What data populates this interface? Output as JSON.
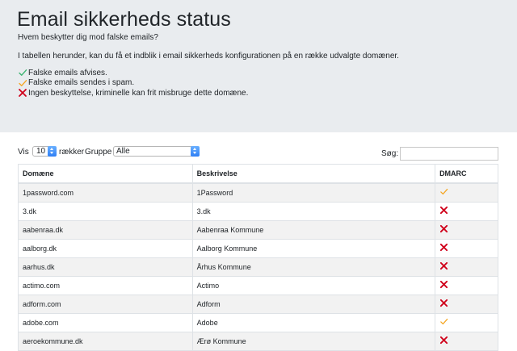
{
  "header": {
    "title": "Email sikkerheds status",
    "lead": "Hvem beskytter dig mod falske emails?",
    "description": "I tabellen herunder, kan du få et indblik i email sikkerheds konfigurationen på en række udvalgte domæner."
  },
  "legend": [
    {
      "icon": "check-green-icon",
      "color": "#3cb371",
      "text": "Falske emails afvises."
    },
    {
      "icon": "check-orange-icon",
      "color": "#f5a623",
      "text": "Falske emails sendes i spam."
    },
    {
      "icon": "cross-red-icon",
      "color": "#d0021b",
      "text": "Ingen beskyttelse, kriminelle kan frit misbruge dette domæne."
    }
  ],
  "controls": {
    "show_label": "Vis",
    "length_value": "10",
    "rows_label": "rækker",
    "group_label": "Gruppe",
    "group_value": "Alle",
    "search_label": "Søg:",
    "search_value": ""
  },
  "table": {
    "columns": [
      "Domæne",
      "Beskrivelse",
      "DMARC"
    ],
    "rows": [
      {
        "domain": "1password.com",
        "description": "1Password",
        "dmarc": "spam"
      },
      {
        "domain": "3.dk",
        "description": "3.dk",
        "dmarc": "none"
      },
      {
        "domain": "aabenraa.dk",
        "description": "Aabenraa Kommune",
        "dmarc": "none"
      },
      {
        "domain": "aalborg.dk",
        "description": "Aalborg Kommune",
        "dmarc": "none"
      },
      {
        "domain": "aarhus.dk",
        "description": "Århus Kommune",
        "dmarc": "none"
      },
      {
        "domain": "actimo.com",
        "description": "Actimo",
        "dmarc": "none"
      },
      {
        "domain": "adform.com",
        "description": "Adform",
        "dmarc": "none"
      },
      {
        "domain": "adobe.com",
        "description": "Adobe",
        "dmarc": "spam"
      },
      {
        "domain": "aeroekommune.dk",
        "description": "Ærø Kommune",
        "dmarc": "none"
      }
    ]
  },
  "colors": {
    "hero_bg": "#e9ecef",
    "check_green": "#3cb371",
    "check_orange": "#f5a623",
    "cross_red": "#d0021b"
  }
}
